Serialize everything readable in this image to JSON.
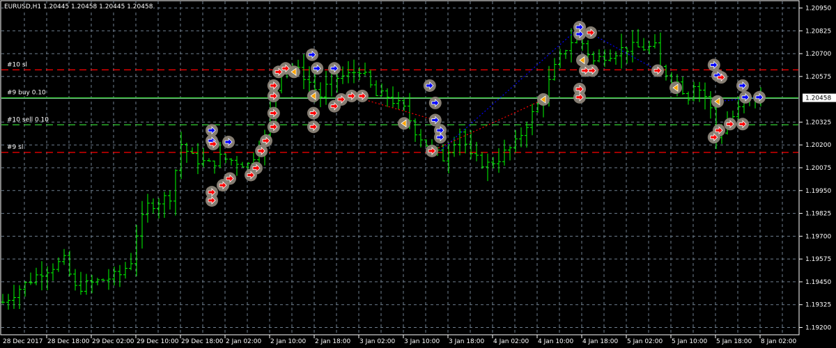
{
  "header": {
    "title": "EURUSD,H1  1.20445 1.20458 1.20445 1.20458"
  },
  "colors": {
    "background": "#000000",
    "grid": "#6f7f8f",
    "bull": "#00ff00",
    "bear": "#00ff00",
    "buy_marker": "#0000ff",
    "sell_marker": "#ff0000",
    "sl_line": "#ff0000",
    "order_line": "#32cd32",
    "marker_bg": "#8c8478"
  },
  "chart_data": {
    "type": "candlestick",
    "symbol": "EURUSD",
    "timeframe": "H1",
    "ylim": [
      1.1916,
      1.2099
    ],
    "y_ticks": [
      "1.20950",
      "1.20825",
      "1.20700",
      "1.20575",
      "1.20325",
      "1.20200",
      "1.20075",
      "1.19950",
      "1.19825",
      "1.19700",
      "1.19575",
      "1.19450",
      "1.19325",
      "1.19200"
    ],
    "current_price": "1.20458",
    "x_labels": [
      "28 Dec 2017",
      "28 Dec 18:00",
      "29 Dec 02:00",
      "29 Dec 10:00",
      "29 Dec 18:00",
      "2 Jan 02:00",
      "2 Jan 10:00",
      "2 Jan 18:00",
      "3 Jan 02:00",
      "3 Jan 10:00",
      "3 Jan 18:00",
      "4 Jan 02:00",
      "4 Jan 10:00",
      "4 Jan 18:00",
      "5 Jan 02:00",
      "5 Jan 10:00",
      "5 Jan 18:00",
      "8 Jan 02:00"
    ],
    "bars_per_label": 8,
    "bar_count": 137,
    "price_path": [
      [
        0,
        1.19339
      ],
      [
        3,
        1.19414
      ],
      [
        7,
        1.19508
      ],
      [
        11,
        1.19565
      ],
      [
        13,
        1.19414
      ],
      [
        17,
        1.19452
      ],
      [
        21,
        1.19489
      ],
      [
        23,
        1.19565
      ],
      [
        24,
        1.19715
      ],
      [
        26,
        1.19866
      ],
      [
        30,
        1.19922
      ],
      [
        32,
        1.20205
      ],
      [
        34,
        1.20129
      ],
      [
        37,
        1.20092
      ],
      [
        39,
        1.20129
      ],
      [
        42,
        1.2011
      ],
      [
        44,
        1.20092
      ],
      [
        47,
        1.20242
      ],
      [
        49,
        1.20506
      ],
      [
        50,
        1.20638
      ],
      [
        52,
        1.20619
      ],
      [
        54,
        1.20581
      ],
      [
        57,
        1.20468
      ],
      [
        59,
        1.20562
      ],
      [
        62,
        1.20581
      ],
      [
        64,
        1.20619
      ],
      [
        67,
        1.20468
      ],
      [
        69,
        1.20468
      ],
      [
        72,
        1.20393
      ],
      [
        74,
        1.2028
      ],
      [
        77,
        1.20167
      ],
      [
        79,
        1.20129
      ],
      [
        82,
        1.2028
      ],
      [
        84,
        1.20129
      ],
      [
        87,
        1.20092
      ],
      [
        89,
        1.20129
      ],
      [
        92,
        1.20205
      ],
      [
        94,
        1.20318
      ],
      [
        97,
        1.20468
      ],
      [
        99,
        1.20619
      ],
      [
        101,
        1.20732
      ],
      [
        103,
        1.20807
      ],
      [
        106,
        1.20656
      ],
      [
        108,
        1.20694
      ],
      [
        112,
        1.20732
      ],
      [
        114,
        1.20732
      ],
      [
        117,
        1.20732
      ],
      [
        118,
        1.20619
      ],
      [
        121,
        1.20543
      ],
      [
        123,
        1.20468
      ],
      [
        124,
        1.20543
      ],
      [
        126,
        1.20468
      ],
      [
        127,
        1.20393
      ],
      [
        128,
        1.20242
      ],
      [
        131,
        1.20355
      ],
      [
        133,
        1.2043
      ],
      [
        135,
        1.20449
      ],
      [
        136,
        1.20458
      ]
    ],
    "levels": [
      {
        "label": "#10 sl",
        "price": 1.20611,
        "kind": "sl"
      },
      {
        "label": "#9 buy 0.10",
        "price": 1.20458,
        "kind": "order"
      },
      {
        "label": "#10 sell 0.10",
        "price": 1.2031,
        "kind": "order-dashed"
      },
      {
        "label": "#9 sl",
        "price": 1.20159,
        "kind": "sl"
      }
    ],
    "markers": [
      [
        37.5,
        1.2028,
        "buy"
      ],
      [
        37.5,
        1.20223,
        "buy"
      ],
      [
        37.75,
        1.20205,
        "sell"
      ],
      [
        40.5,
        1.20216,
        "buy"
      ],
      [
        37.5,
        1.19941,
        "sell"
      ],
      [
        37.5,
        1.19896,
        "sell"
      ],
      [
        39.5,
        1.19979,
        "sell"
      ],
      [
        40.75,
        1.20016,
        "sell"
      ],
      [
        44.5,
        1.20035,
        "sell"
      ],
      [
        45.5,
        1.20073,
        "sell"
      ],
      [
        46.4,
        1.20167,
        "sell"
      ],
      [
        47.25,
        1.20223,
        "sell"
      ],
      [
        48.6,
        1.20299,
        "sell"
      ],
      [
        48.6,
        1.20374,
        "sell"
      ],
      [
        48.6,
        1.20468,
        "sell"
      ],
      [
        48.6,
        1.20525,
        "sell"
      ],
      [
        49.5,
        1.206,
        "sell"
      ],
      [
        50.75,
        1.20619,
        "sell"
      ],
      [
        52.25,
        1.206,
        "close"
      ],
      [
        55.5,
        1.20694,
        "buy"
      ],
      [
        56.4,
        1.20619,
        "buy"
      ],
      [
        55.75,
        1.20468,
        "close"
      ],
      [
        55.75,
        1.20374,
        "sell"
      ],
      [
        55.75,
        1.20299,
        "sell"
      ],
      [
        59.5,
        1.20619,
        "buy"
      ],
      [
        59.5,
        1.20412,
        "sell"
      ],
      [
        60.75,
        1.20449,
        "sell"
      ],
      [
        62.6,
        1.20468,
        "sell"
      ],
      [
        64.5,
        1.20468,
        "sell"
      ],
      [
        72,
        1.20318,
        "close"
      ],
      [
        76.6,
        1.20525,
        "buy"
      ],
      [
        77.6,
        1.2043,
        "buy"
      ],
      [
        77.6,
        1.20336,
        "buy"
      ],
      [
        78.5,
        1.2028,
        "buy"
      ],
      [
        78.5,
        1.20242,
        "buy"
      ],
      [
        77,
        1.20167,
        "sell"
      ],
      [
        97,
        1.20449,
        "close"
      ],
      [
        103.5,
        1.20845,
        "buy"
      ],
      [
        103.5,
        1.20807,
        "buy"
      ],
      [
        105.5,
        1.20815,
        "sell"
      ],
      [
        104,
        1.20664,
        "close"
      ],
      [
        104.5,
        1.20607,
        "sell"
      ],
      [
        105.75,
        1.20607,
        "sell"
      ],
      [
        103.5,
        1.20506,
        "sell"
      ],
      [
        103.5,
        1.20461,
        "sell"
      ],
      [
        117.5,
        1.20607,
        "sell"
      ],
      [
        120.75,
        1.20513,
        "close"
      ],
      [
        127.6,
        1.20638,
        "buy"
      ],
      [
        128.25,
        1.20581,
        "buy"
      ],
      [
        128.9,
        1.2057,
        "sell"
      ],
      [
        128.25,
        1.20438,
        "close"
      ],
      [
        127.6,
        1.20242,
        "sell"
      ],
      [
        128.5,
        1.2028,
        "sell"
      ],
      [
        130.5,
        1.20314,
        "sell"
      ],
      [
        132.75,
        1.20314,
        "sell"
      ],
      [
        132.75,
        1.20525,
        "buy"
      ],
      [
        133.25,
        1.20461,
        "buy"
      ],
      [
        135.75,
        1.20461,
        "buy"
      ]
    ],
    "trade_lines": [
      [
        [
          62.6,
          1.20468
        ],
        [
          77.6,
          1.20336
        ],
        "sell"
      ],
      [
        [
          77,
          1.20167
        ],
        [
          97,
          1.20449
        ],
        "sell"
      ],
      [
        [
          78.5,
          1.20167
        ],
        [
          103.5,
          1.20845
        ],
        "buy"
      ],
      [
        [
          103.5,
          1.20845
        ],
        [
          117.5,
          1.20607
        ],
        "buy"
      ],
      [
        [
          128.25,
          1.20438
        ],
        [
          135.75,
          1.20461
        ],
        "buy"
      ]
    ]
  }
}
